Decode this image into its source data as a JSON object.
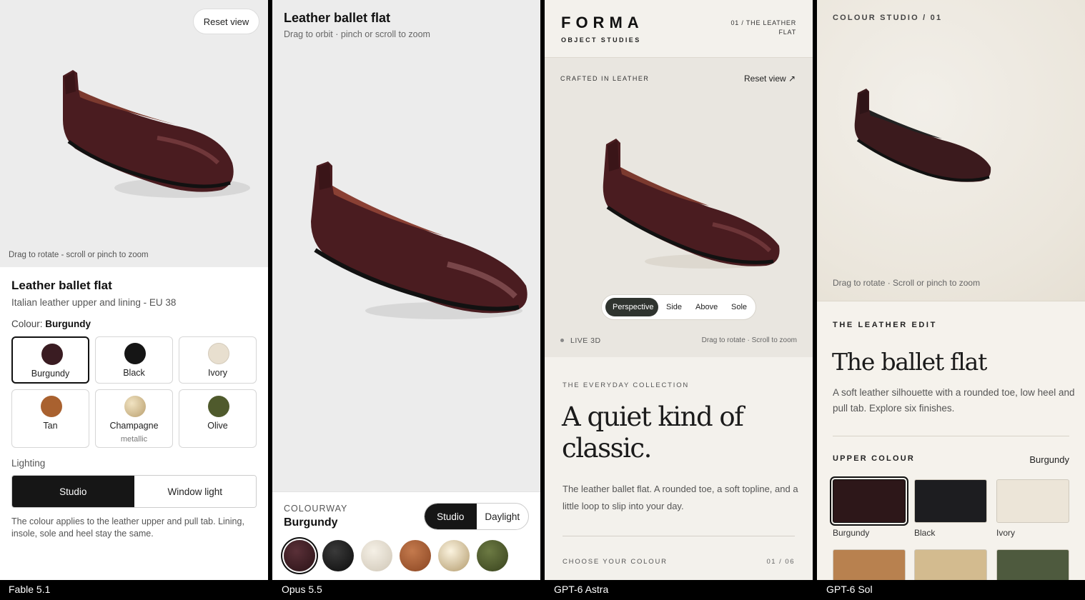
{
  "captions": [
    "Fable 5.1",
    "Opus 5.5",
    "GPT-6 Astra",
    "GPT-6 Sol"
  ],
  "panel1": {
    "reset_label": "Reset view",
    "hint": "Drag to rotate - scroll or pinch to zoom",
    "title": "Leather ballet flat",
    "subtitle": "Italian leather upper and lining - EU 38",
    "colour_label": "Colour:",
    "colour_value": "Burgundy",
    "swatches": [
      {
        "name": "Burgundy",
        "color": "#3a1c22"
      },
      {
        "name": "Black",
        "color": "#151515"
      },
      {
        "name": "Ivory",
        "color": "#e8dfcf"
      },
      {
        "name": "Tan",
        "color": "#a9612f"
      },
      {
        "name": "Champagne",
        "note": "metallic",
        "color": "#d8c39a"
      },
      {
        "name": "Olive",
        "color": "#4f5a2c"
      }
    ],
    "lighting_label": "Lighting",
    "lighting_options": [
      "Studio",
      "Window light"
    ],
    "note": "The colour applies to the leather upper and pull tab. Lining, insole, sole and heel stay the same."
  },
  "panel2": {
    "title": "Leather ballet flat",
    "hint": "Drag to orbit · pinch or scroll to zoom",
    "colourway_label": "COLOURWAY",
    "colourway_value": "Burgundy",
    "light_options": [
      "Studio",
      "Daylight"
    ],
    "swatch_colors": [
      "#3a1c22",
      "#151515",
      "#e6dfd2",
      "#a85a33",
      "#d9c7a0",
      "#4f5d2b"
    ]
  },
  "panel3": {
    "brand": "FORMA",
    "brand_sub": "OBJECT STUDIES",
    "crumb": "01 / THE LEATHER FLAT",
    "crafted": "CRAFTED IN LEATHER",
    "reset_label": "Reset view ↗",
    "views": [
      "Perspective",
      "Side",
      "Above",
      "Sole"
    ],
    "live": "LIVE 3D",
    "drag": "Drag to rotate · Scroll to zoom",
    "collection": "THE EVERYDAY COLLECTION",
    "headline": "A quiet kind of classic.",
    "body": "The leather ballet flat. A rounded toe, a soft topline, and a little loop to slip into your day.",
    "choose": "CHOOSE YOUR COLOUR",
    "count": "01 / 06"
  },
  "panel4": {
    "studio": "COLOUR STUDIO / 01",
    "hint": "Drag to rotate · Scroll or pinch to zoom",
    "edit": "THE LEATHER EDIT",
    "headline": "The ballet flat",
    "body": "A soft leather silhouette with a rounded toe, low heel and pull tab. Explore six finishes.",
    "upper_label": "UPPER COLOUR",
    "upper_value": "Burgundy",
    "tiles": [
      {
        "name": "Burgundy",
        "color": "#2d1719"
      },
      {
        "name": "Black",
        "color": "#1d1d20"
      },
      {
        "name": "Ivory",
        "color": "#ece5d8"
      },
      {
        "name": "",
        "color": "#b8814f"
      },
      {
        "name": "",
        "color": "#d3bb8f"
      },
      {
        "name": "",
        "color": "#4e5a3e"
      }
    ]
  },
  "colors": {
    "shoe_leather": "#4a1c20",
    "shoe_highlight": "#7a3a3c",
    "shoe_lining": "#7c3a2f",
    "dark_ui": "#161616"
  }
}
